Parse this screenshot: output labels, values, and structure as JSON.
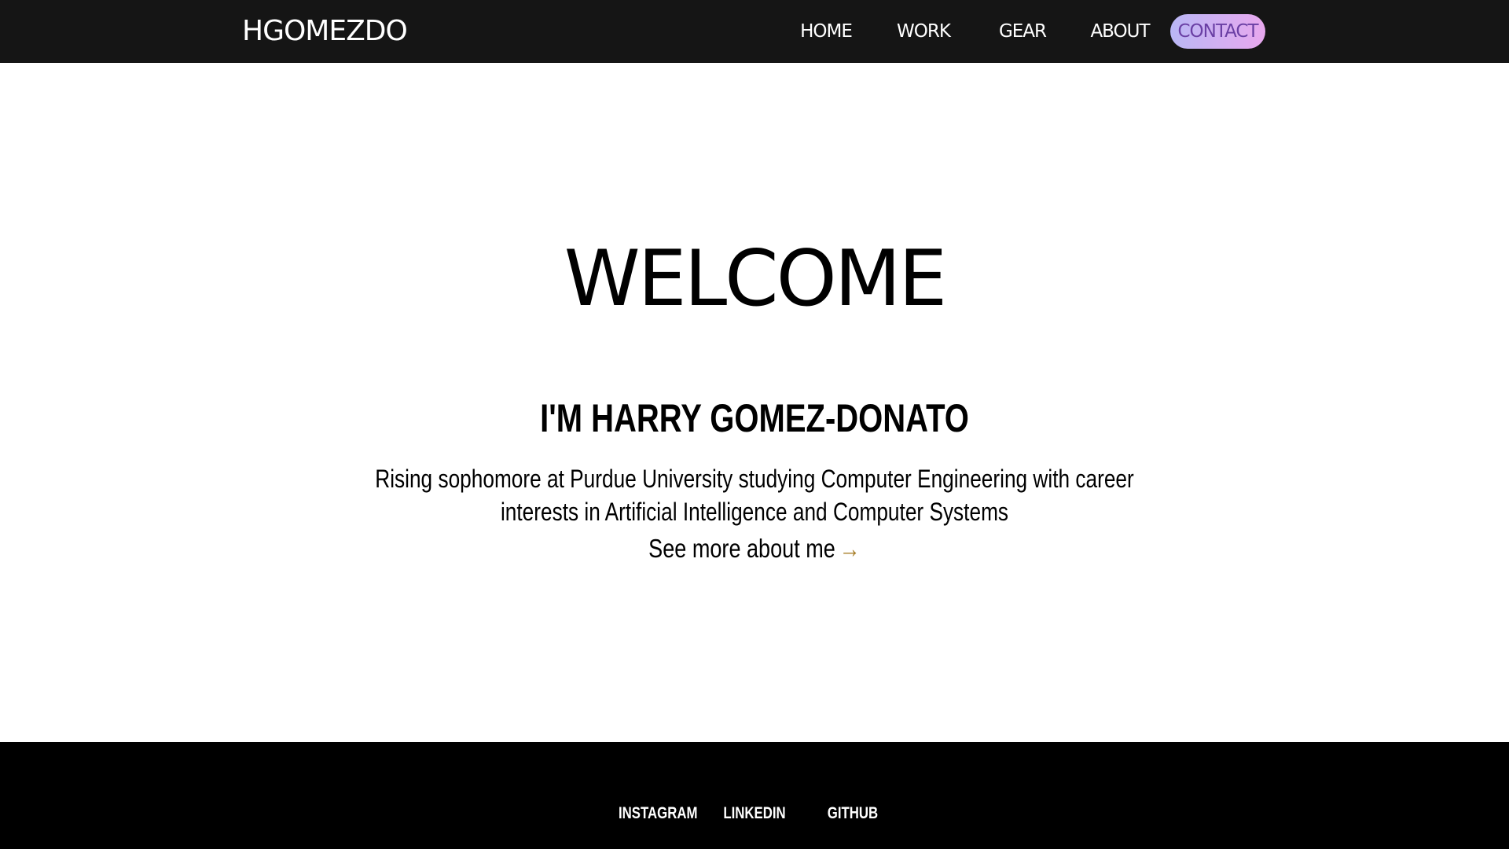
{
  "header": {
    "logo": "HGOMEZDO",
    "nav": {
      "home": "HOME",
      "work": "WORK",
      "gear": "GEAR",
      "about": "ABOUT",
      "contact": "CONTACT"
    }
  },
  "hero": {
    "welcome": "WELCOME",
    "name": "I'M HARRY GOMEZ-DONATO",
    "bio": "Rising sophomore at Purdue University studying Computer Engineering with career interests in Artificial Intelligence and Computer Systems",
    "more_link": "See more about me",
    "more_arrow": "→"
  },
  "footer": {
    "instagram": "INSTAGRAM",
    "linkedin": "LINKEDIN",
    "github": "GITHUB"
  },
  "colors": {
    "topbar": "#151515",
    "footer": "#000000",
    "contact_gradient_start": "#b9b7f5",
    "contact_gradient_end": "#e8a8ee",
    "contact_text": "#6a3fa4",
    "arrow": "#a87f2a"
  }
}
